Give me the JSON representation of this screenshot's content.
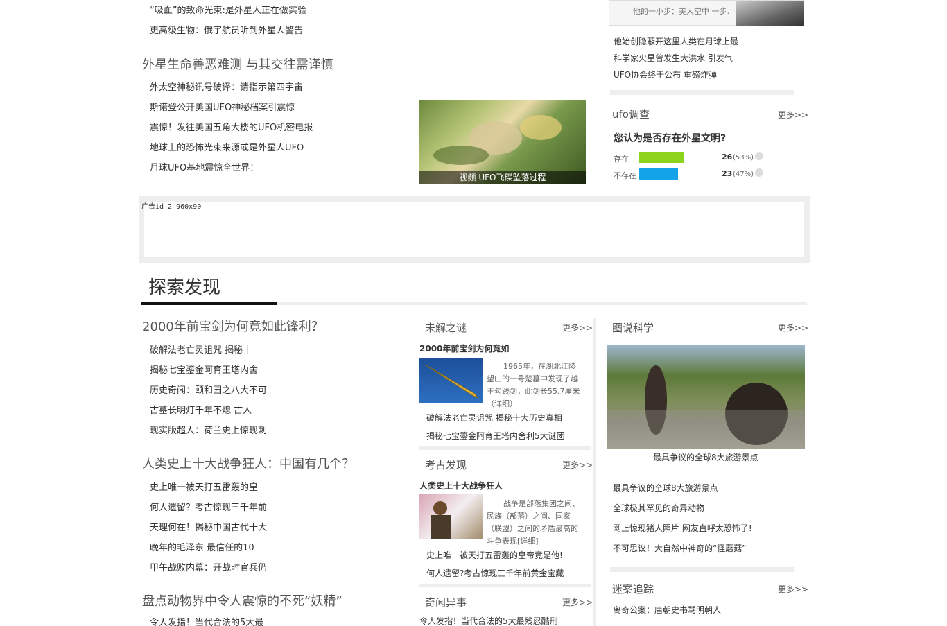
{
  "top_list": [
    "“吸血”的致命光束:是外星人正在做实验",
    "更高级生物：俄宇航员听到外星人警告"
  ],
  "section1": {
    "title": "外星生命善恶难测 与其交往需谨慎",
    "items": [
      "外太空神秘讯号破译：请指示第四宇宙",
      "斯诺登公开美国UFO神秘档案引震惊",
      "震惊！发往美国五角大楼的UFO机密电报",
      "地球上的恐怖光束来源或是外星人UFO",
      "月球UFO基地震惊全世界！"
    ],
    "video_caption": "视频 UFO飞碟坠落过程"
  },
  "right_top": {
    "thumb_text": "他的一小步：美人空中 一步…",
    "items": [
      "他始创隐蔽开这里人类在月球上最",
      "科学家火星曾发生大洪水 引发气",
      "UFO协会终于公布 重磅炸弹"
    ]
  },
  "survey": {
    "title": "ufo调查",
    "more": "更多>>",
    "question": "您认为是否存在外星文明?",
    "options": [
      {
        "label": "存在",
        "count": "26",
        "pct": "(53%)",
        "share": 0.53,
        "color": "#8fd41c"
      },
      {
        "label": "不存在",
        "count": "23",
        "pct": "(47%)",
        "share": 0.47,
        "color": "#13a3e8"
      }
    ]
  },
  "ad": {
    "label": "广告id 2 960x90"
  },
  "explore": {
    "title": "探索发现",
    "groups": [
      {
        "title": "2000年前宝剑为何竟如此锋利？",
        "items": [
          "破解法老亡灵诅咒 揭秘十",
          "揭秘七宝鎏金阿育王塔内舍",
          "历史奇闻：颐和园之八大不可",
          "古墓长明灯千年不熄 古人",
          "现实版超人：荷兰史上惊现刺"
        ]
      },
      {
        "title": "人类史上十大战争狂人：中国有几个？",
        "items": [
          "史上唯一被天打五雷轰的皇",
          "何人遗留？考古惊现三千年前",
          "天理何在！揭秘中国古代十大",
          "晚年的毛泽东 最信任的10",
          "甲午战败内幕：开战时官兵仍"
        ]
      },
      {
        "title": "盘点动物界中令人震惊的不死“妖精”",
        "items": [
          "令人发指！当代合法的5大最"
        ]
      }
    ]
  },
  "mid_boxes": [
    {
      "title": "未解之谜",
      "more": "更多>>",
      "headline": "2000年前宝剑为何竟如",
      "summary": "1965年，在湖北江陵望山的一号楚墓中发现了越王勾践剑，此剑长55.7厘米（详细）",
      "links": [
        "破解法老亡灵诅咒 揭秘十大历史真相",
        "揭秘七宝鎏金阿育王塔内舍利5大谜团"
      ]
    },
    {
      "title": "考古发现",
      "more": "更多>>",
      "headline": "人类史上十大战争狂人",
      "summary": "战争是部落集团之间、民族（部落）之间、国家（联盟）之间的矛盾最高的斗争表现[详细]",
      "links": [
        "史上唯一被天打五雷轰的皇帝竟是他!",
        "何人遗留?考古惊现三千年前黄金宝藏"
      ]
    },
    {
      "title": "奇闻异事",
      "more": "更多>>",
      "links": [
        "令人发指！当代合法的5大最残忍酷刑"
      ]
    }
  ],
  "right_boxes": {
    "pic": {
      "title": "图说科学",
      "more": "更多>>",
      "caption": "最具争议的全球8大旅游景点",
      "items": [
        "最具争议的全球8大旅游景点",
        "全球极其罕见的奇异动物",
        "网上惊现猪人照片 网友直呼太恐怖了!",
        "不可思议！大自然中神奇的“怪蘑菇”"
      ]
    },
    "case": {
      "title": "迷案追踪",
      "more": "更多>>",
      "items": [
        "离奇公案：唐朝史书骂明朝人"
      ]
    }
  }
}
